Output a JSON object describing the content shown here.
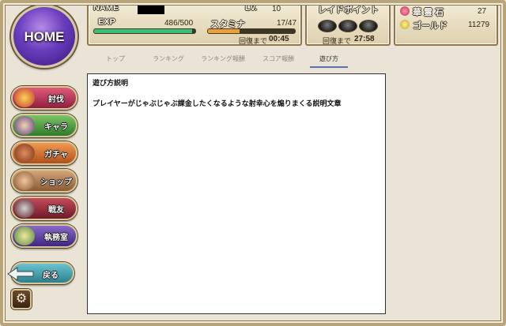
{
  "home": {
    "label": "HOME"
  },
  "status": {
    "name_label": "NAME",
    "lv_label": "Lv.",
    "lv_value": "10",
    "exp_label": "EXP",
    "exp_value": "486/500",
    "exp_ratio": 0.972,
    "stamina_label": "スタミナ",
    "stamina_value": "17/47",
    "stamina_ratio": 0.36,
    "stamina_recover_label": "回復まで",
    "stamina_recover_time": "00:45"
  },
  "raid": {
    "label": "レイドポイント",
    "recover_label": "回復まで",
    "recover_time": "27:58",
    "points_filled": 0
  },
  "currency": {
    "gem_label": "華 霊 石",
    "gem_value": "27",
    "gold_label": "ゴールド",
    "gold_value": "11279"
  },
  "tabs": [
    {
      "label": "トップ"
    },
    {
      "label": "ランキング"
    },
    {
      "label": "ランキング報酬"
    },
    {
      "label": "スコア報酬"
    },
    {
      "label": "遊び方"
    }
  ],
  "active_tab": "遊び方",
  "content": {
    "title": "遊び方説明",
    "body": "プレイヤーがじゃぶじゃぶ課金したくなるような射幸心を煽りまくる説明文章"
  },
  "menu": [
    {
      "label": "討伐",
      "icon": "bee-icon"
    },
    {
      "label": "キャラ",
      "icon": "characters-icon"
    },
    {
      "label": "ガチャ",
      "icon": "pot-icon"
    },
    {
      "label": "ショップ",
      "icon": "coins-icon"
    },
    {
      "label": "戦友",
      "icon": "swords-icon"
    },
    {
      "label": "執務室",
      "icon": "crest-icon"
    }
  ],
  "back": {
    "label": "戻る",
    "icon": "arrow-icon"
  },
  "settings": {
    "icon": "gear-icon"
  },
  "colors": {
    "exp_bar": "#38c078",
    "stamina_bar": "#e9a23a",
    "home_orb": "#6a3dbd"
  }
}
